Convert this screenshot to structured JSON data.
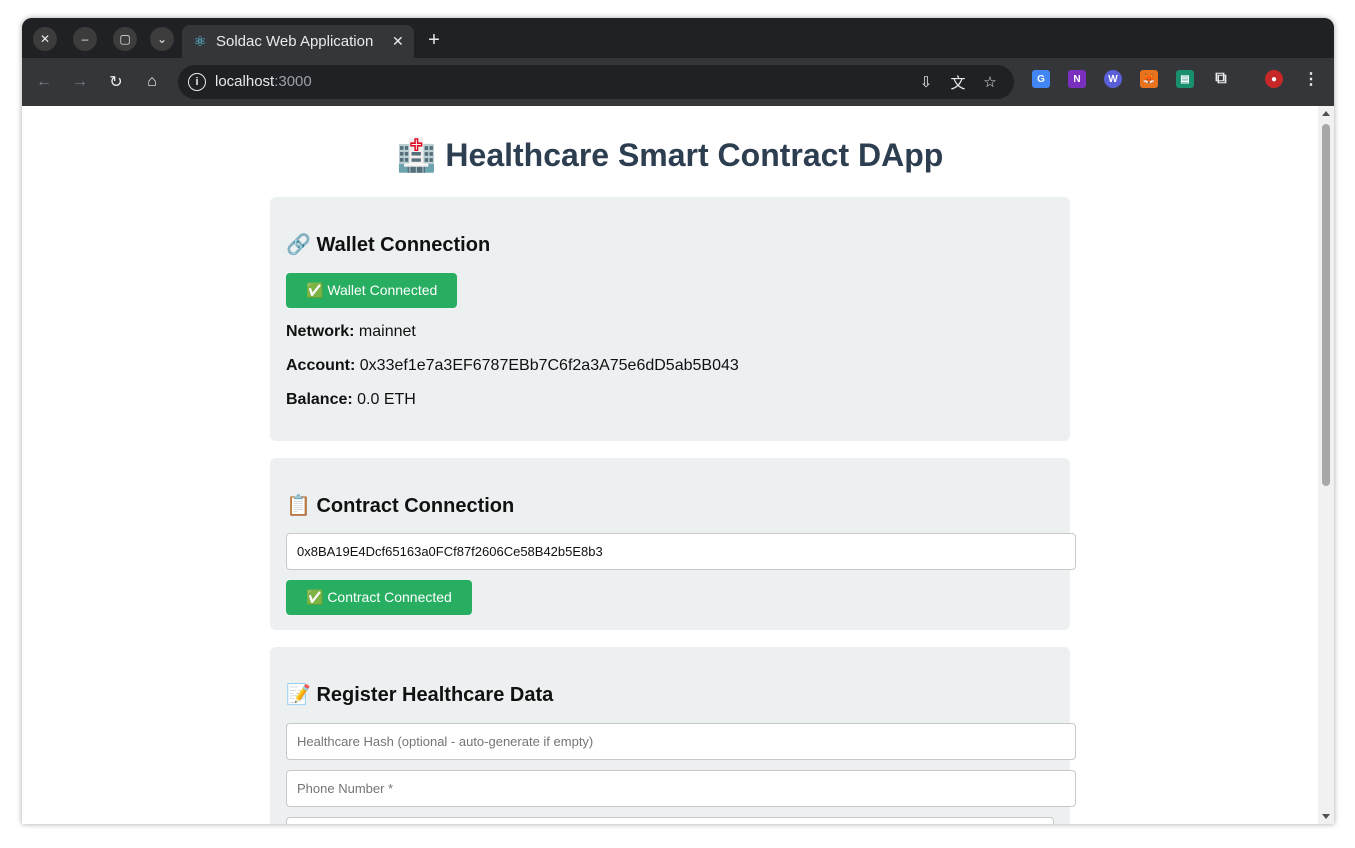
{
  "browser": {
    "tab_title": "Soldac Web Application",
    "tab_icon": "react-icon",
    "url_host": "localhost",
    "url_port": ":3000"
  },
  "page": {
    "title": "🏥 Healthcare Smart Contract DApp",
    "wallet": {
      "heading": "🔗 Wallet Connection",
      "button_label": "✅ Wallet Connected",
      "network_label": "Network:",
      "network_value": "mainnet",
      "account_label": "Account:",
      "account_value": "0x33ef1e7a3EF6787EBb7C6f2a3A75e6dD5ab5B043",
      "balance_label": "Balance:",
      "balance_value": "0.0 ETH"
    },
    "contract": {
      "heading": "📋 Contract Connection",
      "address_value": "0x8BA19E4Dcf65163a0FCf87f2606Ce58B42b5E8b3",
      "button_label": "✅ Contract Connected"
    },
    "register": {
      "heading": "📝 Register Healthcare Data",
      "hash_placeholder": "Healthcare Hash (optional - auto-generate if empty)",
      "phone_placeholder": "Phone Number *"
    }
  },
  "colors": {
    "success": "#27ae60",
    "title": "#2c3e50",
    "card_bg": "#ecf0f1"
  }
}
